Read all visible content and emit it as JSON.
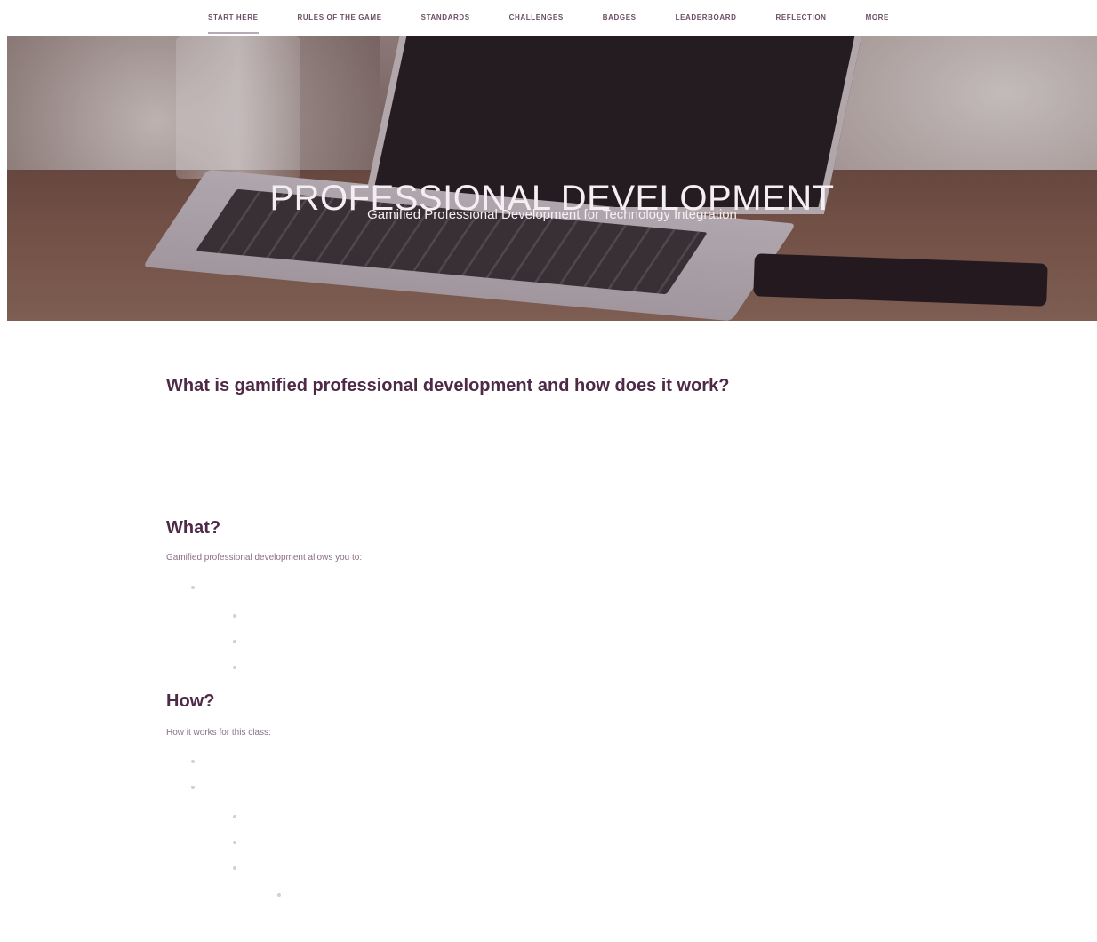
{
  "nav": {
    "items": [
      {
        "label": "Start Here",
        "active": true
      },
      {
        "label": "Rules of the Game",
        "active": false
      },
      {
        "label": "Standards",
        "active": false
      },
      {
        "label": "Challenges",
        "active": false
      },
      {
        "label": "Badges",
        "active": false
      },
      {
        "label": "Leaderboard",
        "active": false
      },
      {
        "label": "Reflection",
        "active": false
      },
      {
        "label": "More",
        "active": false
      }
    ]
  },
  "hero": {
    "title": "PROFESSIONAL DEVELOPMENT",
    "subtitle": "Gamified Professional Development for Technology Integration"
  },
  "main": {
    "heading": "What is gamified professional development and how does it work?",
    "intro": "",
    "what": {
      "heading": "What?",
      "lead": "Gamified professional development allows you to:",
      "items": [
        {
          "label": "",
          "children": [
            {
              "label": ""
            },
            {
              "label": ""
            },
            {
              "label": ""
            }
          ]
        }
      ]
    },
    "how": {
      "heading": "How?",
      "lead": "How it works for this class:",
      "items": [
        {
          "label": ""
        },
        {
          "label": "",
          "children": [
            {
              "label": ""
            },
            {
              "label": ""
            },
            {
              "label": "",
              "children": [
                {
                  "label": ""
                }
              ]
            }
          ]
        }
      ]
    }
  },
  "colors": {
    "nav_text": "#6b4f66",
    "heading": "#4e2a47",
    "hero_title": "#f3eef1"
  }
}
